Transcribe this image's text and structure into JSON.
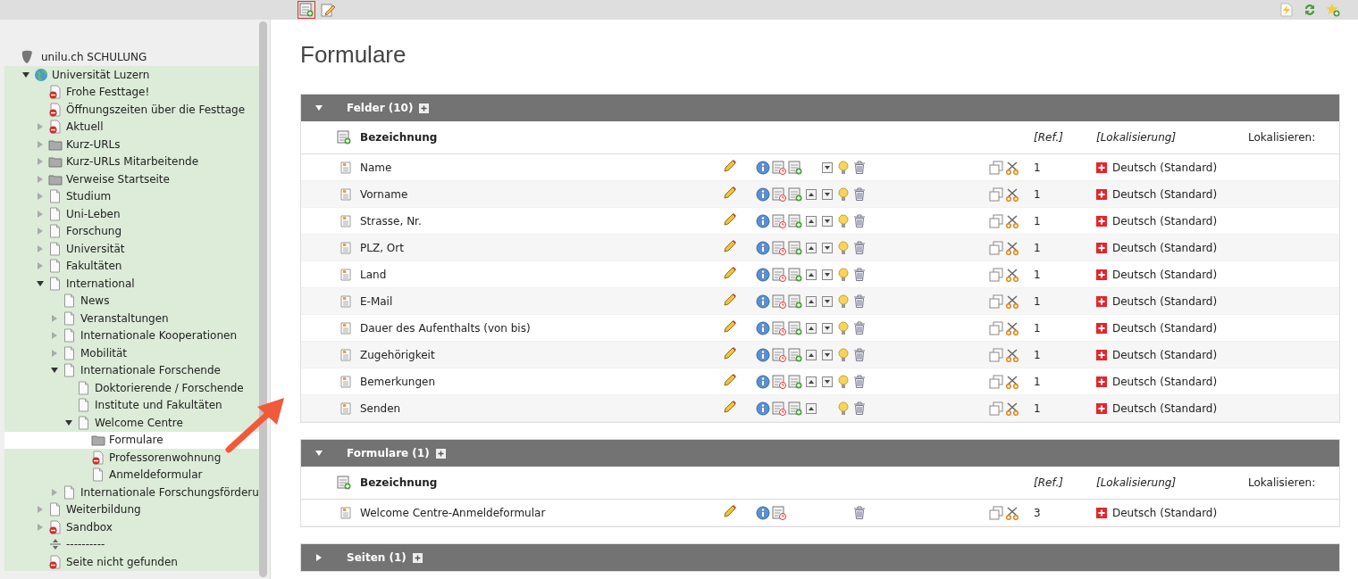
{
  "toolbar": {
    "left": [
      {
        "kind": "new-record",
        "highlighted": true
      },
      {
        "kind": "edit-page",
        "highlighted": false
      }
    ],
    "right": [
      {
        "kind": "clear-cache"
      },
      {
        "kind": "refresh"
      },
      {
        "kind": "bookmark"
      }
    ]
  },
  "tree": {
    "root": "unilu.ch SCHULUNG",
    "items": [
      {
        "label": "Universität Luzern",
        "kind": "globe",
        "expandable": true,
        "expanded": true,
        "selected": false,
        "children": [
          {
            "label": "Frohe Festtage!",
            "kind": "hidden",
            "expandable": false,
            "selected": false
          },
          {
            "label": "Öffnungszeiten über die Festtage",
            "kind": "hidden",
            "expandable": false,
            "selected": false
          },
          {
            "label": "Aktuell",
            "kind": "hidden",
            "expandable": true,
            "expanded": false,
            "selected": false
          },
          {
            "label": "Kurz-URLs",
            "kind": "folder",
            "expandable": true,
            "expanded": false,
            "selected": false
          },
          {
            "label": "Kurz-URLs Mitarbeitende",
            "kind": "folder",
            "expandable": true,
            "expanded": false,
            "selected": false
          },
          {
            "label": "Verweise Startseite",
            "kind": "folder",
            "expandable": true,
            "expanded": false,
            "selected": false
          },
          {
            "label": "Studium",
            "kind": "page",
            "expandable": true,
            "expanded": false,
            "selected": false
          },
          {
            "label": "Uni-Leben",
            "kind": "page",
            "expandable": true,
            "expanded": false,
            "selected": false
          },
          {
            "label": "Forschung",
            "kind": "page",
            "expandable": true,
            "expanded": false,
            "selected": false
          },
          {
            "label": "Universität",
            "kind": "page",
            "expandable": true,
            "expanded": false,
            "selected": false
          },
          {
            "label": "Fakultäten",
            "kind": "page",
            "expandable": true,
            "expanded": false,
            "selected": false
          },
          {
            "label": "International",
            "kind": "page",
            "expandable": true,
            "expanded": true,
            "selected": false,
            "children": [
              {
                "label": "News",
                "kind": "page",
                "expandable": false,
                "selected": false
              },
              {
                "label": "Veranstaltungen",
                "kind": "page",
                "expandable": true,
                "expanded": false,
                "selected": false
              },
              {
                "label": "Internationale Kooperationen",
                "kind": "page",
                "expandable": true,
                "expanded": false,
                "selected": false
              },
              {
                "label": "Mobilität",
                "kind": "page",
                "expandable": true,
                "expanded": false,
                "selected": false
              },
              {
                "label": "Internationale Forschende",
                "kind": "page",
                "expandable": true,
                "expanded": true,
                "selected": false,
                "children": [
                  {
                    "label": "Doktorierende / Forschende",
                    "kind": "page",
                    "expandable": false,
                    "selected": false
                  },
                  {
                    "label": "Institute und Fakultäten",
                    "kind": "page",
                    "expandable": false,
                    "selected": false
                  },
                  {
                    "label": "Welcome Centre",
                    "kind": "page",
                    "expandable": true,
                    "expanded": true,
                    "selected": false,
                    "children": [
                      {
                        "label": "Formulare",
                        "kind": "folder",
                        "expandable": false,
                        "selected": true
                      },
                      {
                        "label": "Professorenwohnung",
                        "kind": "hidden",
                        "expandable": false,
                        "selected": false
                      },
                      {
                        "label": "Anmeldeformular",
                        "kind": "page",
                        "expandable": false,
                        "selected": false
                      }
                    ]
                  }
                ]
              },
              {
                "label": "Internationale Forschungsförderu",
                "kind": "page",
                "expandable": true,
                "expanded": false,
                "selected": false
              }
            ]
          },
          {
            "label": "Weiterbildung",
            "kind": "page",
            "expandable": true,
            "expanded": false,
            "selected": false
          },
          {
            "label": "Sandbox",
            "kind": "hidden",
            "expandable": true,
            "expanded": false,
            "selected": false
          },
          {
            "label": "----------",
            "kind": "separator",
            "expandable": false,
            "selected": false
          },
          {
            "label": "Seite nicht gefunden",
            "kind": "hidden",
            "expandable": false,
            "selected": false
          }
        ]
      }
    ]
  },
  "page_title": "Formulare",
  "sections": [
    {
      "title": "Felder (10)",
      "expanded": true,
      "columns": {
        "title": "Bezeichnung",
        "ref": "[Ref.]",
        "localization": "[Lokalisierung]",
        "localize": "Lokalisieren:"
      },
      "rows": [
        {
          "title": "Name",
          "actions": {
            "info": true,
            "history": true,
            "new": true,
            "up": false,
            "down": true,
            "hide": true,
            "delete": true
          },
          "ref": "1",
          "language": "Deutsch (Standard)"
        },
        {
          "title": "Vorname",
          "actions": {
            "info": true,
            "history": true,
            "new": true,
            "up": true,
            "down": true,
            "hide": true,
            "delete": true
          },
          "ref": "1",
          "language": "Deutsch (Standard)"
        },
        {
          "title": "Strasse, Nr.",
          "actions": {
            "info": true,
            "history": true,
            "new": true,
            "up": true,
            "down": true,
            "hide": true,
            "delete": true
          },
          "ref": "1",
          "language": "Deutsch (Standard)"
        },
        {
          "title": "PLZ, Ort",
          "actions": {
            "info": true,
            "history": true,
            "new": true,
            "up": true,
            "down": true,
            "hide": true,
            "delete": true
          },
          "ref": "1",
          "language": "Deutsch (Standard)"
        },
        {
          "title": "Land",
          "actions": {
            "info": true,
            "history": true,
            "new": true,
            "up": true,
            "down": true,
            "hide": true,
            "delete": true
          },
          "ref": "1",
          "language": "Deutsch (Standard)"
        },
        {
          "title": "E-Mail",
          "actions": {
            "info": true,
            "history": true,
            "new": true,
            "up": true,
            "down": true,
            "hide": true,
            "delete": true
          },
          "ref": "1",
          "language": "Deutsch (Standard)"
        },
        {
          "title": "Dauer des Aufenthalts (von bis)",
          "actions": {
            "info": true,
            "history": true,
            "new": true,
            "up": true,
            "down": true,
            "hide": true,
            "delete": true
          },
          "ref": "1",
          "language": "Deutsch (Standard)"
        },
        {
          "title": "Zugehörigkeit",
          "actions": {
            "info": true,
            "history": true,
            "new": true,
            "up": true,
            "down": true,
            "hide": true,
            "delete": true
          },
          "ref": "1",
          "language": "Deutsch (Standard)"
        },
        {
          "title": "Bemerkungen",
          "actions": {
            "info": true,
            "history": true,
            "new": true,
            "up": true,
            "down": true,
            "hide": true,
            "delete": true
          },
          "ref": "1",
          "language": "Deutsch (Standard)"
        },
        {
          "title": "Senden",
          "actions": {
            "info": true,
            "history": true,
            "new": true,
            "up": true,
            "down": false,
            "hide": true,
            "delete": true
          },
          "ref": "1",
          "language": "Deutsch (Standard)"
        }
      ]
    },
    {
      "title": "Formulare (1)",
      "expanded": true,
      "columns": {
        "title": "Bezeichnung",
        "ref": "[Ref.]",
        "localization": "[Lokalisierung]",
        "localize": "Lokalisieren:"
      },
      "rows": [
        {
          "title": "Welcome Centre-Anmeldeformular",
          "actions": {
            "info": true,
            "history": true,
            "new": false,
            "up": false,
            "down": false,
            "hide": false,
            "delete": true
          },
          "ref": "3",
          "language": "Deutsch (Standard)"
        }
      ]
    },
    {
      "title": "Seiten (1)",
      "expanded": false
    }
  ]
}
